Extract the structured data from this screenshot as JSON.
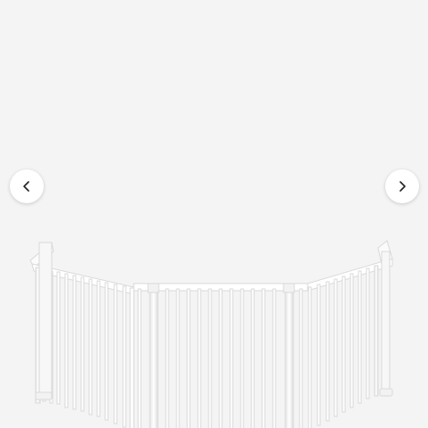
{
  "carousel": {
    "background": "#f5f4f4",
    "product_color": "#ffffff",
    "prev_button": {
      "icon": "chevron-left-icon"
    },
    "next_button": {
      "icon": "chevron-right-icon"
    }
  }
}
